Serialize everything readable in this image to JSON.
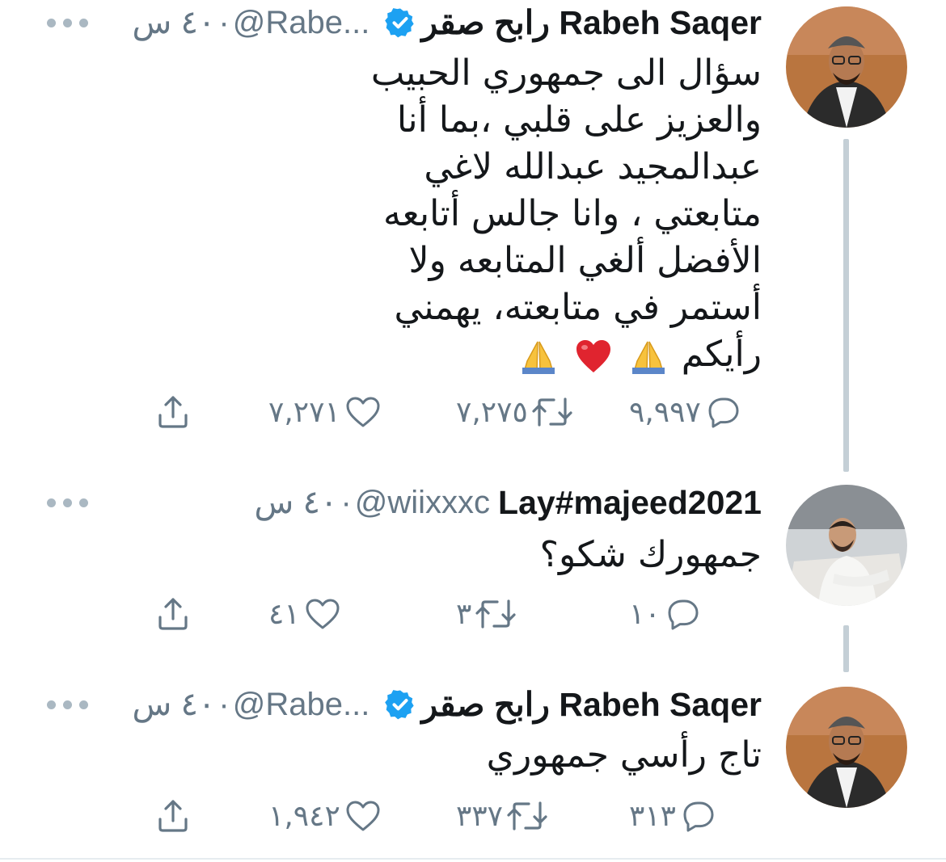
{
  "tweets": [
    {
      "name": "رابح صقر Rabeh Saqer",
      "verified": true,
      "handle": "@Rabe...",
      "separator": "·",
      "time": "٤٠ س",
      "body_lines": [
        "سؤال الى جمهوري الحبيب",
        "والعزيز على قلبي ،بما أنا",
        "عبدالمجيد عبدالله لاغي",
        "متابعتي ، وانا جالس أتابعه",
        "الأفضل ألغي المتابعه ولا",
        "أستمر في متابعته، يهمني",
        "رأيكم"
      ],
      "emojis": [
        "folded-hands",
        "red-heart",
        "folded-hands"
      ],
      "replies": "٩,٩٩٧",
      "retweets": "٧,٢٧٥",
      "likes": "٧,٢٧١"
    },
    {
      "name": "Lay#majeed2021",
      "verified": false,
      "handle": "@wiixxxc",
      "separator": "·",
      "time": "٤٠ س",
      "body_lines": [
        "جمهورك شكو؟"
      ],
      "replies": "١٠",
      "retweets": "٣",
      "likes": "٤١"
    },
    {
      "name": "رابح صقر Rabeh Saqer",
      "verified": true,
      "handle": "@Rabe...",
      "separator": "·",
      "time": "٤٠ س",
      "body_lines": [
        "تاج رأسي جمهوري"
      ],
      "replies": "٣١٣",
      "retweets": "٣٣٧",
      "likes": "١,٩٤٢"
    }
  ],
  "icons": {
    "reply": "reply-bubble-icon",
    "retweet": "retweet-icon",
    "like": "heart-icon",
    "share": "share-icon",
    "more": "more-dots-icon",
    "verified": "verified-badge-icon"
  },
  "colors": {
    "text": "#14171a",
    "secondary": "#657786",
    "verified": "#1da1f2",
    "thread_line": "#c4cfd6"
  }
}
